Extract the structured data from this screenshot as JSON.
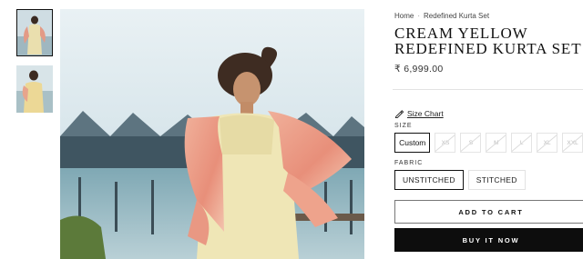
{
  "breadcrumb": {
    "home": "Home",
    "separator": "·",
    "current": "Redefined Kurta Set"
  },
  "product": {
    "title_line1": "CREAM YELLOW",
    "title_line2": "REDEFINED KURTA SET",
    "price": "₹ 6,999.00"
  },
  "size_chart": {
    "label": "Size Chart",
    "icon": "ruler-pencil-icon"
  },
  "size": {
    "label": "SIZE",
    "selected": "Custom",
    "options": [
      "Custom",
      "XS",
      "S",
      "M",
      "L",
      "XL",
      "XXL"
    ]
  },
  "fabric": {
    "label": "FABRIC",
    "options": [
      "UNSTITCHED",
      "STITCHED"
    ],
    "selected": "UNSTITCHED"
  },
  "actions": {
    "add_to_cart": "ADD TO CART",
    "buy_now": "BUY IT NOW"
  },
  "thumbnails": [
    {
      "active": true
    },
    {
      "active": false
    }
  ],
  "colors": {
    "accent": "#0d0d0d",
    "dupatta": "#e8a08a",
    "kurta": "#efe7b8",
    "sky": "#c9dde6"
  }
}
